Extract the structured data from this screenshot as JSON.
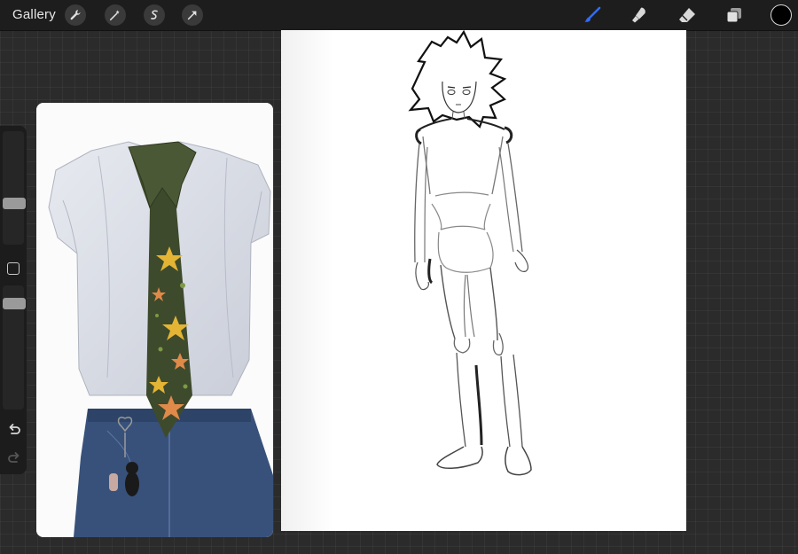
{
  "topbar": {
    "gallery_label": "Gallery",
    "left_tools": [
      "wrench-icon",
      "magic-wand-icon",
      "selection-icon",
      "transform-arrow-icon"
    ],
    "right_tools": [
      "brush-icon",
      "smudge-icon",
      "eraser-icon",
      "layers-icon"
    ],
    "active_tool": "brush-icon",
    "active_color": "#000000",
    "accent_color": "#2f6bff"
  },
  "sidebar": {
    "brush_size_level": 0.35,
    "opacity_level": 0.18,
    "icons": [
      "modify-square-icon",
      "undo-icon",
      "redo-icon"
    ]
  },
  "reference": {
    "content": "reference-image"
  },
  "canvas": {
    "background": "#ffffff"
  }
}
